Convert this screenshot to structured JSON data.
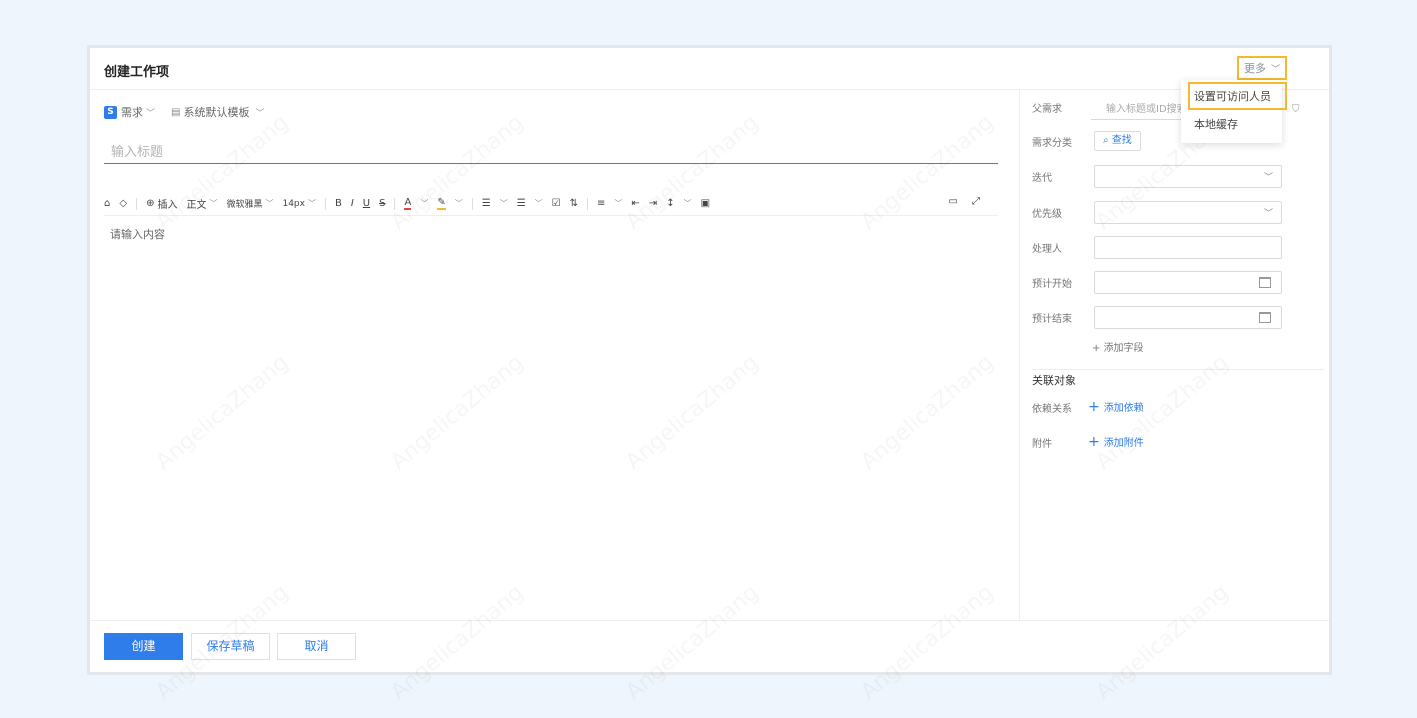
{
  "dialog": {
    "title": "创建工作项"
  },
  "more": {
    "label": "更多",
    "menu": [
      "设置可访问人员",
      "本地缓存"
    ]
  },
  "editor": {
    "type_label": "需求",
    "type_badge": "S",
    "template_label": "系统默认模板",
    "title_placeholder": "输入标题",
    "toolbar": {
      "insert": "插入",
      "paragraph": "正文",
      "font": "微软雅黑",
      "size": "14px"
    },
    "body_placeholder": "请输入内容"
  },
  "sidebar": {
    "parent_label": "父需求",
    "parent_placeholder": "输入标题或ID搜索",
    "category_label": "需求分类",
    "find_label": "查找",
    "iteration_label": "迭代",
    "priority_label": "优先级",
    "assignee_label": "处理人",
    "start_label": "预计开始",
    "end_label": "预计结束",
    "add_field_label": "添加字段",
    "related_title": "关联对象",
    "dependency_label": "依赖关系",
    "add_dependency": "添加依赖",
    "attachment_label": "附件",
    "add_attachment": "添加附件"
  },
  "footer": {
    "create": "创建",
    "save_draft": "保存草稿",
    "cancel": "取消"
  },
  "watermark": "AngelicaZhang",
  "colors": {
    "primary": "#2f7dea",
    "highlight": "#f5b82e",
    "error_line": "#e64545"
  }
}
